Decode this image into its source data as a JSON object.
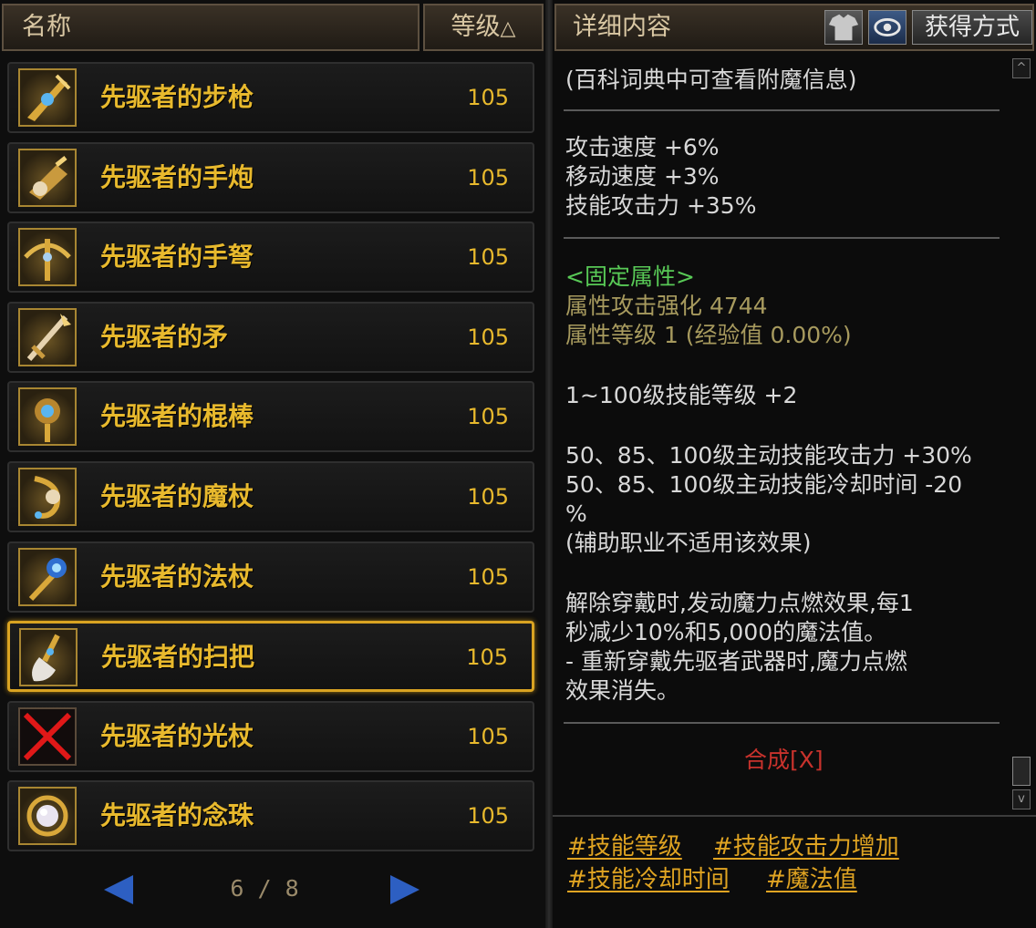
{
  "list_header": {
    "name_label": "名称",
    "level_label": "等级",
    "sort_indicator": "△"
  },
  "items": [
    {
      "name": "先驱者的步枪",
      "level": "105",
      "icon": "rifle-icon"
    },
    {
      "name": "先驱者的手炮",
      "level": "105",
      "icon": "hand-cannon-icon"
    },
    {
      "name": "先驱者的手弩",
      "level": "105",
      "icon": "crossbow-icon"
    },
    {
      "name": "先驱者的矛",
      "level": "105",
      "icon": "spear-icon"
    },
    {
      "name": "先驱者的棍棒",
      "level": "105",
      "icon": "club-icon"
    },
    {
      "name": "先驱者的魔杖",
      "level": "105",
      "icon": "wand-icon"
    },
    {
      "name": "先驱者的法杖",
      "level": "105",
      "icon": "staff-icon"
    },
    {
      "name": "先驱者的扫把",
      "level": "105",
      "icon": "broom-icon",
      "selected": true
    },
    {
      "name": "先驱者的光杖",
      "level": "105",
      "icon": "missing-icon-red-x"
    },
    {
      "name": "先驱者的念珠",
      "level": "105",
      "icon": "rosary-icon"
    }
  ],
  "pager": {
    "text": "6 / 8"
  },
  "detail_header": {
    "title": "详细内容",
    "obtain_button": "获得方式"
  },
  "detail": {
    "enchant_hint": "(百科词典中可查看附魔信息)",
    "stats": [
      "攻击速度 +6%",
      "移动速度 +3%",
      "技能攻击力 +35%"
    ],
    "fixed_attr_title": "<固定属性>",
    "fixed_attrs": [
      "属性攻击强化 4744",
      "属性等级 1 (经验值 0.00%)"
    ],
    "skill_level": "1~100级技能等级 +2",
    "active_skill_lines": [
      "50、85、100级主动技能攻击力 +30%",
      "50、85、100级主动技能冷却时间 -20",
      "%"
    ],
    "support_note": "(辅助职业不适用该效果)",
    "unequip_lines": [
      "解除穿戴时,发动魔力点燃效果,每1",
      "秒减少10%和5,000的魔法值。",
      "- 重新穿戴先驱者武器时,魔力点燃",
      "效果消失。"
    ],
    "synthesis": "合成[X]"
  },
  "tags": [
    "#技能等级",
    "#技能攻击力增加",
    "#技能冷却时间",
    "#魔法值"
  ],
  "colors": {
    "item_text": "#e8b92d",
    "selected_border": "#d9a322",
    "fixed_attr_title": "#58c956",
    "fixed_attr": "#a79a5e",
    "synthesis": "#c8322c",
    "tag": "#e0a422",
    "pager_arrow": "#2d5fc2"
  }
}
